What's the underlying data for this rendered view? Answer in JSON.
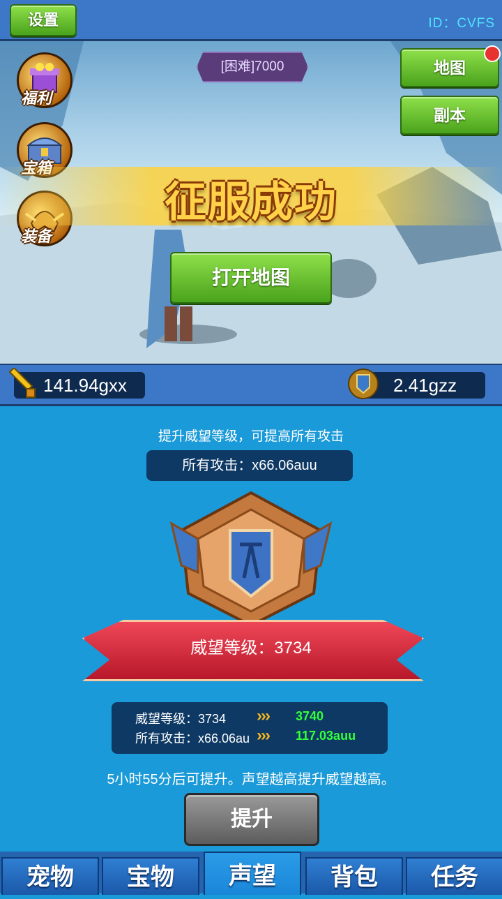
{
  "header": {
    "settings_label": "设置",
    "id_text": "ID：CVFS"
  },
  "scene": {
    "difficulty_label": "[困难]7000",
    "side_icons": [
      {
        "label": "福利",
        "icon": "gift-box-icon"
      },
      {
        "label": "宝箱",
        "icon": "treasure-chest-icon"
      },
      {
        "label": "装备",
        "icon": "helmet-icon"
      }
    ],
    "map_button": "地图",
    "dungeon_button": "副本",
    "victory_text": "征服成功",
    "open_map_button": "打开地图"
  },
  "resources": {
    "attack_value": "141.94gxx",
    "prestige_value": "2.41gzz"
  },
  "prestige": {
    "hint": "提升威望等级，可提高所有攻击",
    "all_attack_label": "所有攻击：x66.06auu",
    "ribbon_text": "威望等级：3734",
    "compare": [
      {
        "label": "威望等级：3734",
        "arrows": "›››",
        "next": "3740"
      },
      {
        "label": "所有攻击：x66.06au",
        "arrows": "›››",
        "next": "117.03auu"
      }
    ],
    "timer_text": "5小时55分后可提升。声望越高提升威望越高。",
    "upgrade_button": "提升"
  },
  "tabs": [
    {
      "label": "宠物",
      "active": false
    },
    {
      "label": "宝物",
      "active": false
    },
    {
      "label": "声望",
      "active": true
    },
    {
      "label": "背包",
      "active": false
    },
    {
      "label": "任务",
      "active": false
    }
  ],
  "colors": {
    "accent_green": "#5fbf26",
    "next_value_green": "#34ff3a",
    "panel_blue": "#1a9ad8"
  }
}
